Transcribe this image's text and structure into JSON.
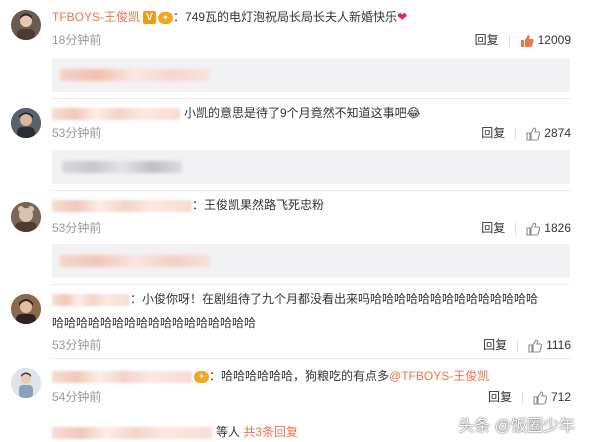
{
  "comments": [
    {
      "username": "TFBOYS-王俊凯",
      "text": "749瓦的电灯泡祝局长局长夫人新婚快乐",
      "time": "18分钟前",
      "reply": "回复",
      "likes": "12009",
      "avatar_icon": "user-avatar-icon"
    },
    {
      "username": "",
      "text": "小凯的意思是待了9个月竟然不知道这事吧😂",
      "time": "53分钟前",
      "reply": "回复",
      "likes": "2874"
    },
    {
      "username": "",
      "text": "：王俊凯果然路飞死忠粉",
      "time": "53分钟前",
      "reply": "回复",
      "likes": "1826"
    },
    {
      "username": "",
      "text_line1": "：小俊你呀！在剧组待了九个月都没看出来吗哈哈哈哈哈哈哈哈哈哈哈哈哈哈",
      "text_line2": "哈哈哈哈哈哈哈哈哈哈哈哈哈哈哈哈哈",
      "time": "53分钟前",
      "reply": "回复",
      "likes": "1116"
    },
    {
      "username": "",
      "text": "：哈哈哈哈哈哈，狗粮吃的有点多",
      "mention": "@TFBOYS-王俊凯",
      "time": "54分钟前",
      "reply": "回复",
      "likes": "712"
    }
  ],
  "more_replies": {
    "prefix": "等人",
    "link": "共3条回复"
  },
  "watermark": "头条 @饭圈少年",
  "colors": {
    "username": "#eb7350",
    "like_active": "#eb7350",
    "like_idle": "#888888"
  }
}
